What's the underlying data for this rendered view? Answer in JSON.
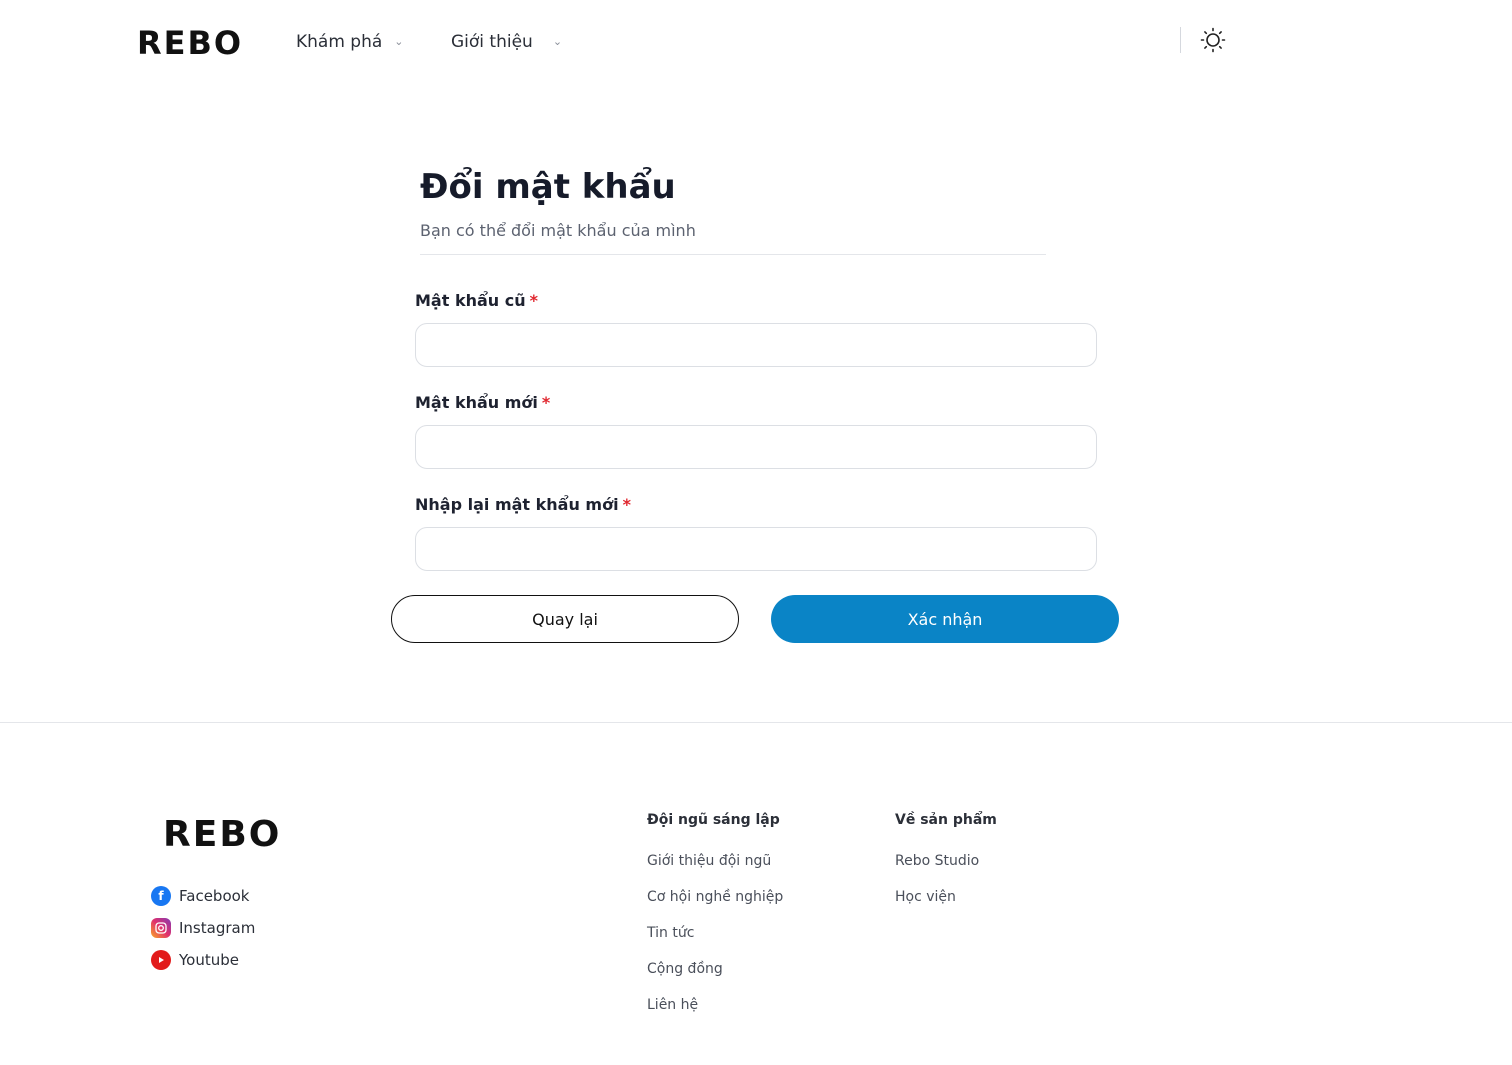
{
  "header": {
    "logo": "REBO",
    "nav": [
      {
        "label": "Khám phá"
      },
      {
        "label": "Giới thiệu"
      }
    ]
  },
  "form": {
    "title": "Đổi mật khẩu",
    "subtitle": "Bạn có thể đổi mật khẩu của mình",
    "fields": [
      {
        "label": "Mật khẩu cũ",
        "required_mark": "*",
        "value": ""
      },
      {
        "label": "Mật khẩu mới",
        "required_mark": "*",
        "value": ""
      },
      {
        "label": "Nhập lại mật khẩu mới",
        "required_mark": "*",
        "value": ""
      }
    ],
    "back_label": "Quay lại",
    "confirm_label": "Xác nhận"
  },
  "footer": {
    "logo": "REBO",
    "social": [
      {
        "label": "Facebook",
        "icon": "facebook-icon"
      },
      {
        "label": "Instagram",
        "icon": "instagram-icon"
      },
      {
        "label": "Youtube",
        "icon": "youtube-icon"
      }
    ],
    "columns": [
      {
        "title": "Đội ngũ sáng lập",
        "links": [
          "Giới thiệu đội ngũ",
          "Cơ hội nghề nghiệp",
          "Tin tức",
          "Cộng đồng",
          "Liên hệ"
        ]
      },
      {
        "title": "Về sản phẩm",
        "links": [
          "Rebo Studio",
          "Học viện"
        ]
      }
    ]
  },
  "colors": {
    "accent": "#0a84c6",
    "required": "#e0262e",
    "text": "#161b2a"
  }
}
